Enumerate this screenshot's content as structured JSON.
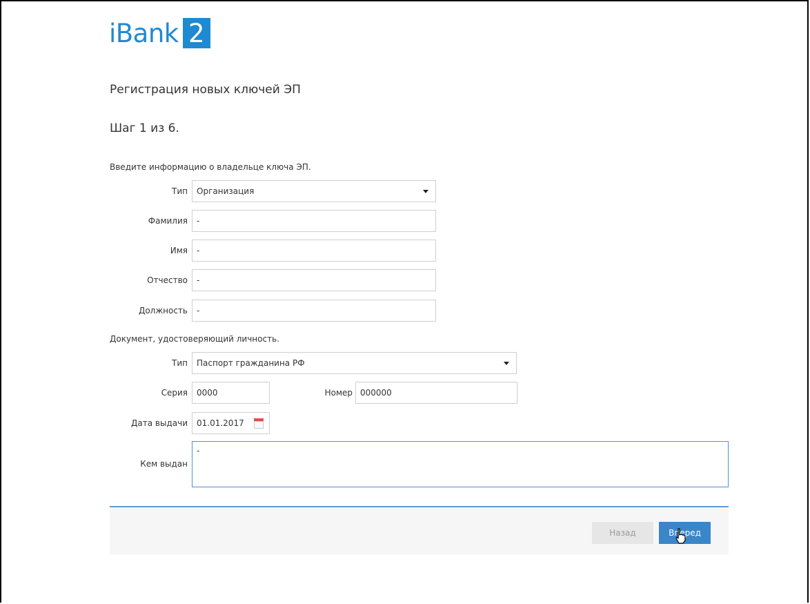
{
  "app": {
    "logo_text": "iBank",
    "logo_num": "2"
  },
  "header": {
    "title": "Регистрация новых ключей ЭП",
    "step": "Шаг 1 из 6."
  },
  "owner": {
    "section_label": "Введите информацию о владельце ключа ЭП.",
    "type_label": "Тип",
    "type_value": "Организация",
    "lastname_label": "Фамилия",
    "lastname_value": "-",
    "firstname_label": "Имя",
    "firstname_value": "-",
    "patronymic_label": "Отчество",
    "patronymic_value": "-",
    "position_label": "Должность",
    "position_value": "-"
  },
  "document": {
    "section_label": "Документ, удостоверяющий личность.",
    "type_label": "Тип",
    "type_value": "Паспорт гражданина РФ",
    "series_label": "Серия",
    "series_value": "0000",
    "number_label": "Номер",
    "number_value": "000000",
    "issue_date_label": "Дата выдачи",
    "issue_date_value": "01.01.2017",
    "issued_by_label": "Кем выдан",
    "issued_by_value": "-"
  },
  "footer": {
    "back_label": "Назад",
    "next_label": "Вперед"
  },
  "icons": {
    "dropdown": "chevron-down-icon",
    "calendar": "calendar-icon",
    "cursor": "hand-pointer-icon"
  },
  "colors": {
    "brand": "#1e8ad2",
    "primary_button": "#3a86c8",
    "focus_border": "#4a90d9"
  }
}
